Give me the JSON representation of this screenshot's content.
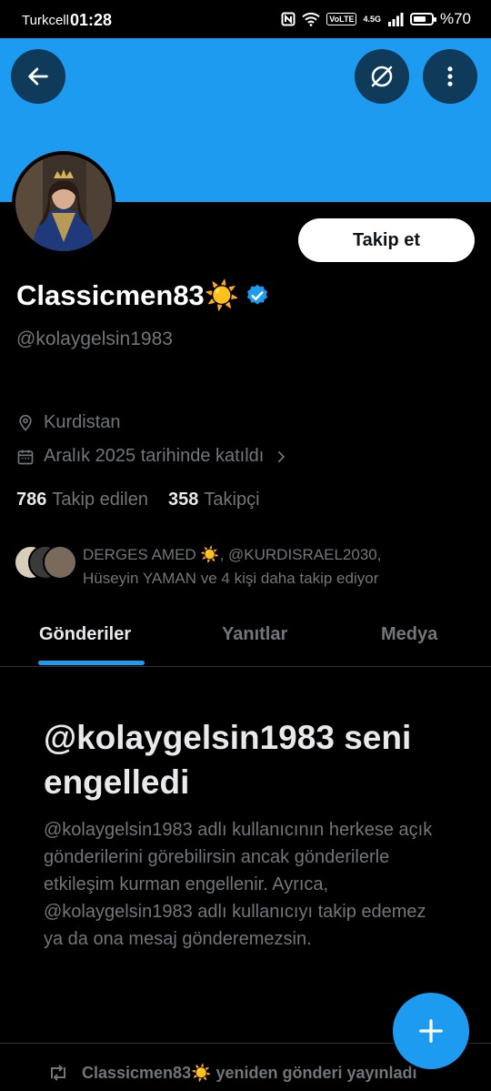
{
  "status_bar": {
    "carrier": "Turkcell",
    "time": "01:28",
    "network_label": "4.5G",
    "volte_label": "VoLTE",
    "battery_text": "%70",
    "battery_level": 0.7
  },
  "header": {
    "back_icon": "arrow-left-icon",
    "hide_icon": "eye-slash-circle-icon",
    "more_icon": "more-vertical-icon",
    "banner_color": "#1d9bf0"
  },
  "profile": {
    "display_name": "Classicmen83☀️",
    "verified": true,
    "handle": "@kolaygelsin1983",
    "location": "Kurdistan",
    "joined": "Aralık 2025 tarihinde katıldı",
    "following_count": "786",
    "following_label": "Takip edilen",
    "followers_count": "358",
    "followers_label": "Takipçi",
    "follow_button": "Takip et",
    "known_followers_line1": "DERGES AMED ☀️, @KURDISRAEL2030,",
    "known_followers_line2": "Hüseyin YAMAN ve 4 kişi daha takip ediyor"
  },
  "tabs": [
    {
      "label": "Gönderiler",
      "active": true
    },
    {
      "label": "Yanıtlar",
      "active": false
    },
    {
      "label": "Medya",
      "active": false
    }
  ],
  "blocked": {
    "title": "@kolaygelsin1983 seni engelledi",
    "description": "@kolaygelsin1983 adlı kullanıcının herkese açık gönderilerini görebilirsin ancak gönderilerle etkileşim kurman engellenir. Ayrıca, @kolaygelsin1983 adlı kullanıcıyı takip edemez ya da ona mesaj gönderemezsin."
  },
  "repost_notice": "Classicmen83☀️ yeniden gönderi yayınladı",
  "fab_icon": "plus-icon",
  "colors": {
    "accent": "#1d9bf0",
    "background": "#000000",
    "secondary_text": "#71767b"
  }
}
